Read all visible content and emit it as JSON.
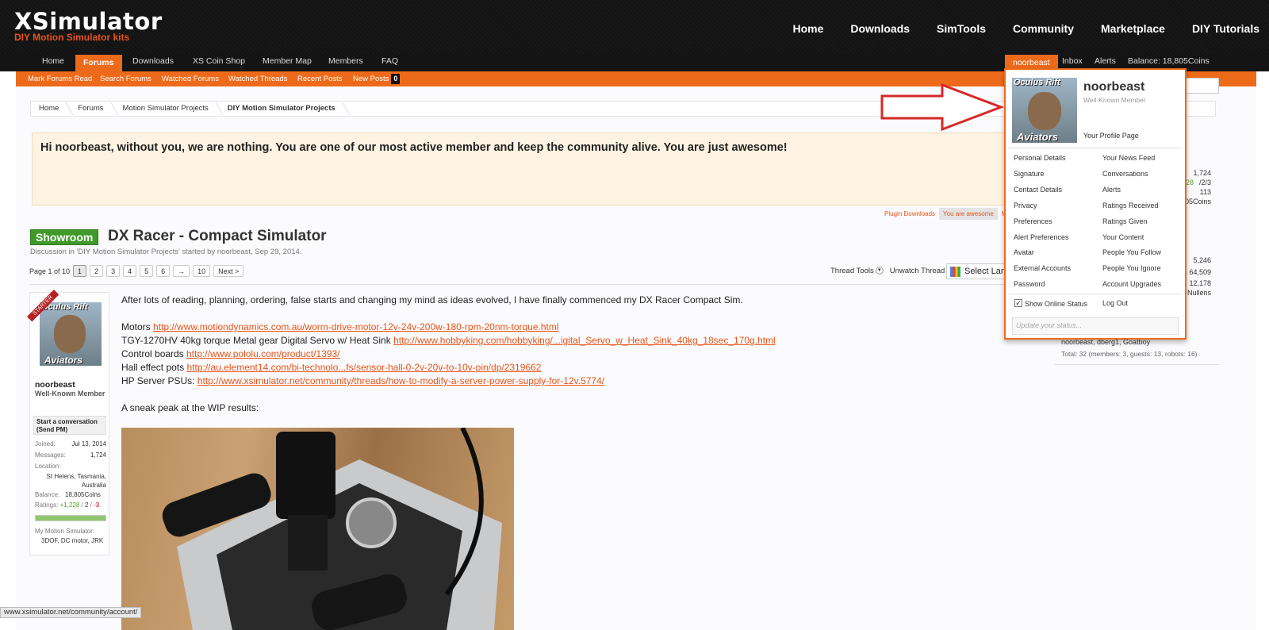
{
  "header": {
    "logo": "XSimulator",
    "tagline": "DIY Motion Simulator kits",
    "top_nav": [
      "Home",
      "Downloads",
      "SimTools",
      "Community",
      "Marketplace",
      "DIY Tutorials"
    ]
  },
  "nav": {
    "home": "Home",
    "forums": "Forums",
    "downloads": "Downloads",
    "coin_shop": "XS Coin Shop",
    "member_map": "Member Map",
    "members": "Members",
    "faq": "FAQ",
    "user": "noorbeast",
    "inbox": "Inbox",
    "alerts": "Alerts",
    "balance": "Balance: 18,805Coins"
  },
  "subnav": {
    "mark_read": "Mark Forums Read",
    "search": "Search Forums",
    "watched_forums": "Watched Forums",
    "watched_threads": "Watched Threads",
    "recent": "Recent Posts",
    "new_posts": "New Posts",
    "new_posts_count": "0"
  },
  "breadcrumb": [
    "Home",
    "Forums",
    "Motion Simulator Projects",
    "DIY Motion Simulator Projects"
  ],
  "notice": "Hi noorbeast, without you, we are nothing. You are one of our most active member and keep the community alive. You are just awesome!",
  "footer_links": [
    "Plugin Downloads",
    "You are awesome",
    "Ma"
  ],
  "thread": {
    "prefix": "Showroom",
    "title": "DX Racer - Compact Simulator",
    "meta": "Discussion in 'DIY Motion Simulator Projects' started by noorbeast, Sep 29, 2014.",
    "page_info": "Page 1 of 10",
    "pages": [
      "1",
      "2",
      "3",
      "4",
      "5",
      "6",
      "→",
      "10",
      "Next >"
    ],
    "tools": "Thread Tools",
    "unwatch": "Unwatch Thread",
    "language": "Select Lan"
  },
  "user_panel": {
    "badge": "STARTER",
    "avatar_top": "Oculus Rift",
    "avatar_bottom": "Aviators",
    "name": "noorbeast",
    "title": "Well-Known Member",
    "conversation": "Start a conversation (Send PM)",
    "joined_label": "Joined:",
    "joined": "Jul 13, 2014",
    "messages_label": "Messages:",
    "messages": "1,724",
    "location_label": "Location:",
    "location": "St Helens, Tasmania, Australia",
    "balance_label": "Balance:",
    "balance": "18,805Coins",
    "ratings_label": "Ratings:",
    "ratings_pos": "+1,228",
    "ratings_mid": "2",
    "ratings_neg": "-3",
    "sim_label": "My Motion Simulator:",
    "sim": "3DOF, DC motor, JRK"
  },
  "post": {
    "intro": "After lots of reading, planning, ordering, false starts and changing my mind as ideas evolved, I have finally commenced my DX Racer Compact Sim.",
    "lines": [
      {
        "label": "Motors ",
        "link": "http://www.motiondynamics.com.au/worm-drive-motor-12v-24v-200w-180-rpm-20nm-torque.html"
      },
      {
        "label": "TGY-1270HV 40kg torque Metal gear Digital Servo w/ Heat Sink ",
        "link": "http://www.hobbyking.com/hobbyking/...igital_Servo_w_Heat_Sink_40kg_18sec_170g.html"
      },
      {
        "label": "Control boards ",
        "link": "http://www.pololu.com/product/1393/"
      },
      {
        "label": "Hall effect pots ",
        "link": "http://au.element14.com/bi-technolo...fs/sensor-hall-0-2v-20v-to-10v-pin/dp/2319662"
      },
      {
        "label": "HP Server PSUs: ",
        "link": "http://www.xsimulator.net/community/threads/how-to-modify-a-server-power-supply-for-12v.5774/"
      }
    ],
    "sneak": "A sneak peak at the WIP results:"
  },
  "account_dropdown": {
    "avatar_top": "Oculus Rift",
    "avatar_bottom": "Aviators",
    "name": "noorbeast",
    "title": "Well-Known Member",
    "profile": "Your Profile Page",
    "left": [
      "Personal Details",
      "Signature",
      "Contact Details",
      "Privacy",
      "Preferences",
      "Alert Preferences",
      "Avatar",
      "External Accounts",
      "Password"
    ],
    "right": [
      "Your News Feed",
      "Conversations",
      "Alerts",
      "Ratings Received",
      "Ratings Given",
      "Your Content",
      "People You Follow",
      "People You Ignore",
      "Account Upgrades"
    ],
    "show_online": "Show Online Status",
    "logout": "Log Out",
    "status_placeholder": "Update your status..."
  },
  "sidebar_ghost": {
    "v1": "1,724",
    "v2": "228",
    "v2b": "/2/3",
    "v3": "113",
    "v4": "05Coins",
    "s1": "5,246",
    "s2": "64,509",
    "s3": "12,178",
    "s4": "Nullens",
    "online": "noorbeast, dberg1, Goatboy",
    "total": "Total: 32 (members: 3, guests: 13, robots: 16)"
  },
  "status_url": "www.xsimulator.net/community/account/",
  "colors": {
    "accent": "#ee6a1b",
    "link": "#e8541a",
    "showroom": "#3f9a2a",
    "notice_bg": "#fff3e3"
  }
}
